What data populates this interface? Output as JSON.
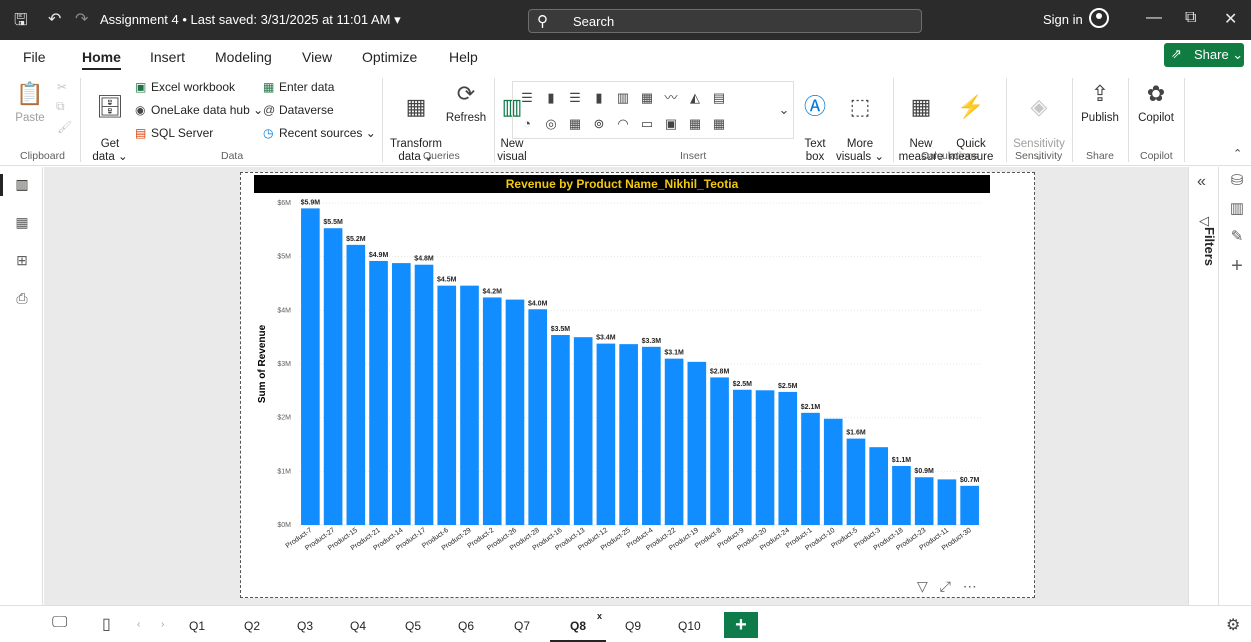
{
  "titlebar": {
    "doc_title": "Assignment 4 • Last saved: 3/31/2025 at 11:01 AM ▾",
    "search_placeholder": "Search",
    "sign_in": "Sign in"
  },
  "menu": {
    "tabs": [
      "File",
      "Home",
      "Insert",
      "Modeling",
      "View",
      "Optimize",
      "Help"
    ],
    "active": "Home",
    "share_label": "Share ⌄"
  },
  "ribbon": {
    "paste": "Paste",
    "get_data": "Get\ndata ⌄",
    "excel_workbook": "Excel workbook",
    "onelake": "OneLake data hub ⌄",
    "sql_server": "SQL Server",
    "enter_data": "Enter data",
    "dataverse": "Dataverse",
    "recent_sources": "Recent sources ⌄",
    "transform_data": "Transform\ndata ⌄",
    "refresh": "Refresh",
    "new_visual": "New\nvisual",
    "text_box": "Text\nbox",
    "more_visuals": "More\nvisuals ⌄",
    "new_measure": "New\nmeasure",
    "quick_measure": "Quick\nmeasure",
    "sensitivity": "Sensitivity\n⌄",
    "publish": "Publish",
    "copilot": "Copilot",
    "groups": {
      "clipboard": "Clipboard",
      "data": "Data",
      "queries": "Queries",
      "insert": "Insert",
      "calculations": "Calculations",
      "sensitivity": "Sensitivity",
      "share": "Share",
      "copilot": "Copilot"
    }
  },
  "filters_label": "Filters",
  "pages": {
    "tabs": [
      "Q1",
      "Q2",
      "Q3",
      "Q4",
      "Q5",
      "Q6",
      "Q7",
      "Q8",
      "Q9",
      "Q10"
    ],
    "active": "Q8",
    "close_mark": "x",
    "add_label": "+"
  },
  "colors": {
    "bar": "#118dff",
    "title_bg": "#000000",
    "title_text": "#f2c811",
    "share_green": "#107c41"
  },
  "chart_data": {
    "type": "bar",
    "title": "Revenue by Product Name_Nikhil_Teotia",
    "xlabel": "",
    "ylabel": "Sum of Revenue",
    "ylim": [
      0,
      6000000
    ],
    "y_ticks": [
      "$0M",
      "$1M",
      "$2M",
      "$3M",
      "$4M",
      "$5M",
      "$6M"
    ],
    "grid": true,
    "categories": [
      "Product-7",
      "Product-27",
      "Product-15",
      "Product-21",
      "Product-14",
      "Product-17",
      "Product-6",
      "Product-29",
      "Product-2",
      "Product-26",
      "Product-28",
      "Product-16",
      "Product-13",
      "Product-12",
      "Product-25",
      "Product-4",
      "Product-22",
      "Product-19",
      "Product-8",
      "Product-9",
      "Product-20",
      "Product-24",
      "Product-1",
      "Product-10",
      "Product-5",
      "Product-3",
      "Product-18",
      "Product-23",
      "Product-11",
      "Product-30"
    ],
    "values": [
      5900000,
      5530000,
      5220000,
      4920000,
      4880000,
      4850000,
      4460000,
      4460000,
      4240000,
      4200000,
      4020000,
      3540000,
      3500000,
      3380000,
      3370000,
      3320000,
      3100000,
      3040000,
      2750000,
      2520000,
      2510000,
      2480000,
      2090000,
      1980000,
      1610000,
      1450000,
      1100000,
      890000,
      850000,
      730000
    ],
    "data_labels": [
      "$5.9M",
      "$5.5M",
      "$5.2M",
      "$4.9M",
      "",
      "$4.8M",
      "$4.5M",
      "",
      "$4.2M",
      "",
      "$4.0M",
      "$3.5M",
      "",
      "$3.4M",
      "",
      "$3.3M",
      "$3.1M",
      "",
      "$2.8M",
      "$2.5M",
      "",
      "$2.5M",
      "$2.1M",
      "",
      "$1.6M",
      "",
      "$1.1M",
      "$0.9M",
      "",
      "$0.7M"
    ]
  }
}
